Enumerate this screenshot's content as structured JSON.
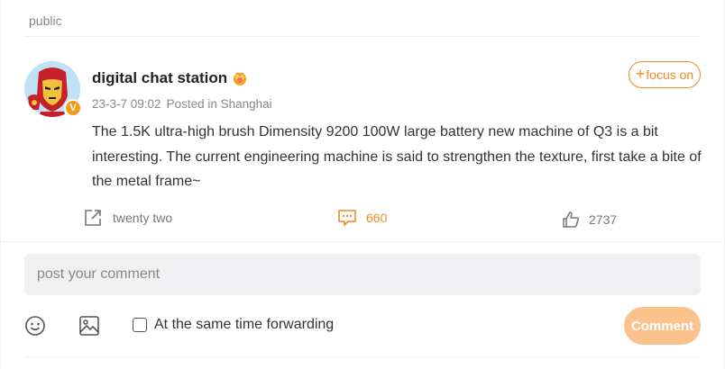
{
  "section": {
    "label": "public"
  },
  "post": {
    "username": "digital chat station",
    "badge_letter": "V",
    "date": "23-3-7 09:02",
    "location": "Posted in Shanghai",
    "follow_label": "focus on",
    "follow_prefix": "+",
    "body": "The 1.5K ultra-high brush Dimensity 9200 100W large battery new machine of Q3 is a bit interesting. The current engineering machine is said to strengthen the texture, first take a bite of the metal frame~",
    "actions": {
      "repost": "twenty two",
      "comments": "660",
      "likes": "2737"
    }
  },
  "composer": {
    "placeholder": "post your comment",
    "forward_label": "At the same time forwarding",
    "submit_label": "Comment"
  },
  "colors": {
    "accent": "#f08a24",
    "submit_disabled": "#fcc28c",
    "input_bg": "#f0f0f2"
  },
  "icons": [
    "crown-icon",
    "share-icon",
    "comment-icon",
    "like-icon",
    "emoji-icon",
    "image-icon"
  ]
}
